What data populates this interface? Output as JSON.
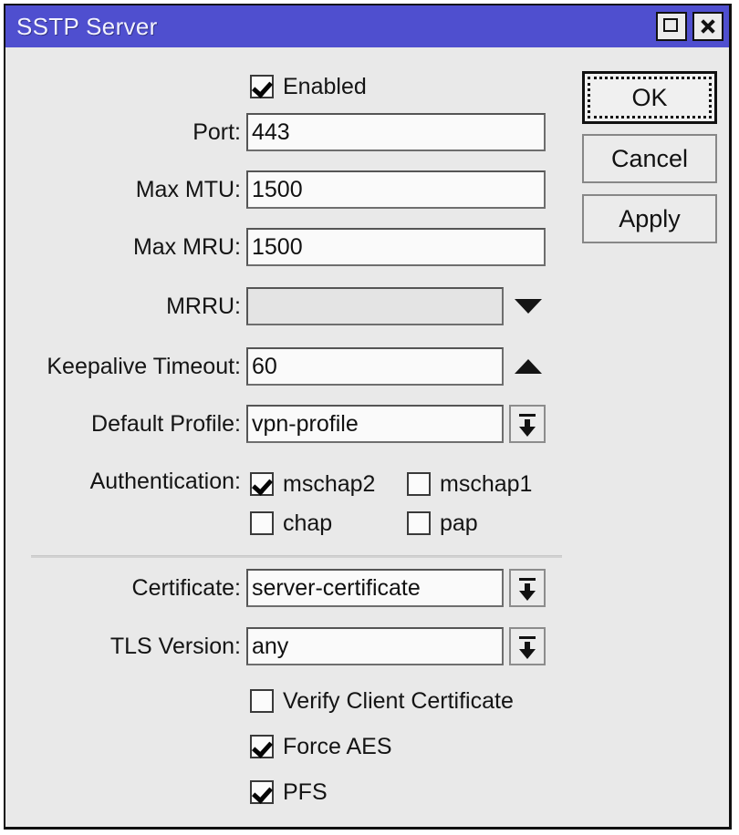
{
  "window": {
    "title": "SSTP Server",
    "titlebar_color": "#4f4fcf",
    "face_color": "#e9e9e9",
    "maximize_icon": "maximize-icon",
    "close_icon": "close-icon"
  },
  "buttons": {
    "ok": "OK",
    "cancel": "Cancel",
    "apply": "Apply"
  },
  "form": {
    "enabled": {
      "label": "Enabled",
      "checked": true
    },
    "port": {
      "label": "Port:",
      "value": "443"
    },
    "max_mtu": {
      "label": "Max MTU:",
      "value": "1500"
    },
    "max_mru": {
      "label": "Max MRU:",
      "value": "1500"
    },
    "mrru": {
      "label": "MRRU:",
      "value": "",
      "disabled": true,
      "arrow_icon": "triangle-down-icon"
    },
    "keepalive_timeout": {
      "label": "Keepalive Timeout:",
      "value": "60",
      "arrow_icon": "triangle-up-icon"
    },
    "default_profile": {
      "label": "Default Profile:",
      "value": "vpn-profile",
      "dropdown_icon": "dropdown-arrow-icon"
    },
    "authentication": {
      "label": "Authentication:",
      "options": [
        {
          "name": "mschap2",
          "checked": true
        },
        {
          "name": "mschap1",
          "checked": false
        },
        {
          "name": "chap",
          "checked": false
        },
        {
          "name": "pap",
          "checked": false
        }
      ]
    },
    "certificate": {
      "label": "Certificate:",
      "value": "server-certificate",
      "dropdown_icon": "dropdown-arrow-icon"
    },
    "tls_version": {
      "label": "TLS Version:",
      "value": "any",
      "dropdown_icon": "dropdown-arrow-icon"
    },
    "verify_client_certificate": {
      "label": "Verify Client Certificate",
      "checked": false
    },
    "force_aes": {
      "label": "Force AES",
      "checked": true
    },
    "pfs": {
      "label": "PFS",
      "checked": true
    }
  }
}
